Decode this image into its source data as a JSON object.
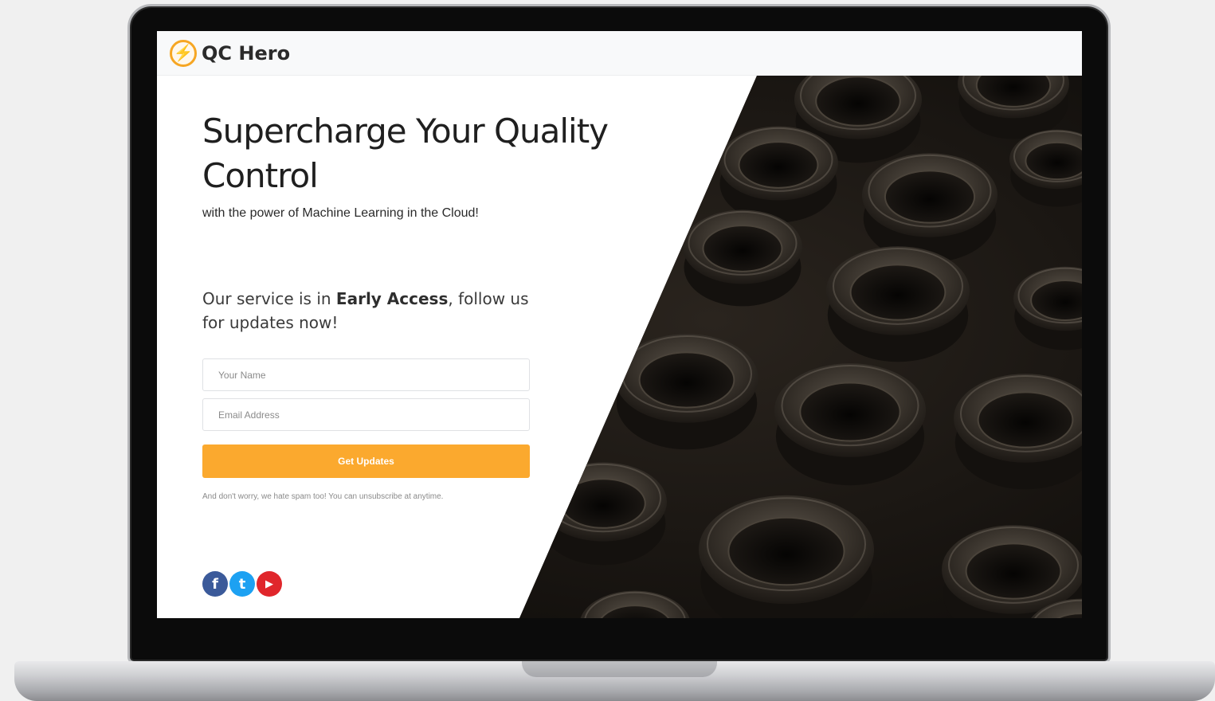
{
  "brand": {
    "name": "QC Hero",
    "logo_icon": "lightning-bolt-icon",
    "logo_glyph": "⚡",
    "accent_color": "#f6a623"
  },
  "hero": {
    "headline": "Supercharge Your Quality Control",
    "subline": "with the power of Machine Learning in the Cloud!",
    "early_prefix": "Our service is in ",
    "early_bold": "Early Access",
    "early_suffix": ", follow us for updates now!"
  },
  "form": {
    "name_placeholder": "Your Name",
    "email_placeholder": "Email Address",
    "submit_label": "Get Updates",
    "submit_color": "#fba92e",
    "note": "And don't worry, we hate spam too! You can unsubscribe at anytime."
  },
  "social": [
    {
      "name": "facebook-icon",
      "glyph": "f",
      "color": "#3b5a9a"
    },
    {
      "name": "twitter-icon",
      "glyph": "t",
      "color": "#1da1f2"
    },
    {
      "name": "youtube-icon",
      "glyph": "▶",
      "color": "#e0262b"
    }
  ]
}
